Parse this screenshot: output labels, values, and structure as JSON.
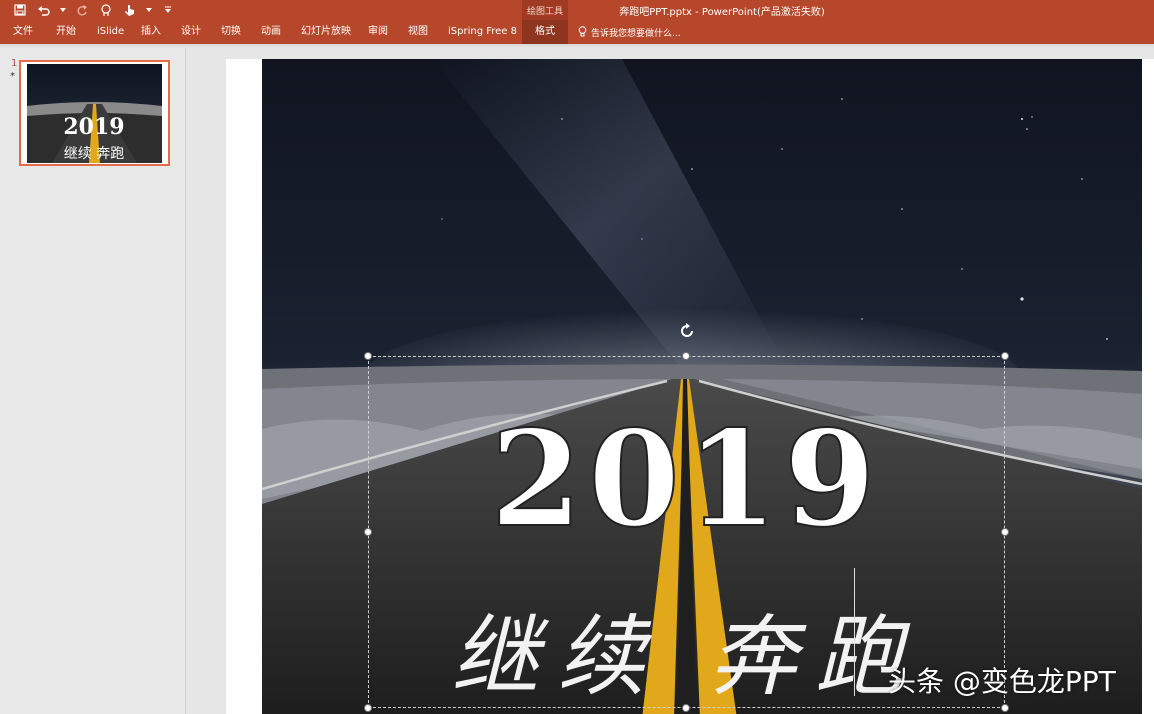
{
  "window": {
    "title": "奔跑吧PPT.pptx - PowerPoint(产品激活失败)",
    "contextual_group": "绘图工具"
  },
  "quick_access": [
    "save-icon",
    "undo-icon",
    "redo-icon",
    "touch-mode-icon",
    "customize-icon"
  ],
  "ribbon": {
    "tabs": [
      {
        "label": "文件"
      },
      {
        "label": "开始"
      },
      {
        "label": "iSlide"
      },
      {
        "label": "插入"
      },
      {
        "label": "设计"
      },
      {
        "label": "切换"
      },
      {
        "label": "动画"
      },
      {
        "label": "幻灯片放映"
      },
      {
        "label": "审阅"
      },
      {
        "label": "视图"
      },
      {
        "label": "iSpring Free 8"
      },
      {
        "label": "格式",
        "active": true
      }
    ],
    "tell_me": "告诉我您想要做什么..."
  },
  "thumbnails": [
    {
      "number": "1",
      "marker": "*",
      "selected": true
    }
  ],
  "slide": {
    "year": "2019",
    "subtitle": "继续 奔跑"
  },
  "watermark": "头条 @变色龙PPT",
  "colors": {
    "ribbon": "#b7472a",
    "selection": "#e46c4a",
    "road_line": "#e0a81a"
  }
}
